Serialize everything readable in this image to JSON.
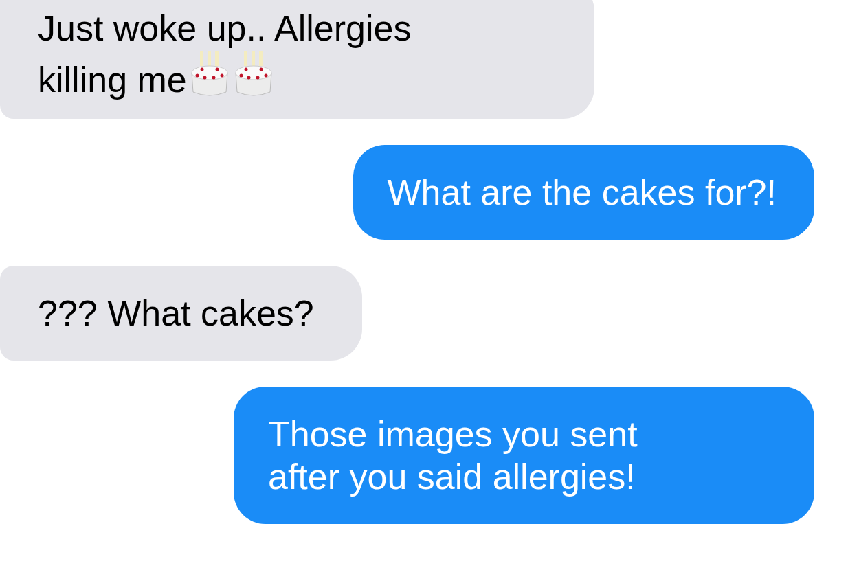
{
  "messages": [
    {
      "kind": "incoming",
      "parts": [
        {
          "kind": "text",
          "text": "Just woke up.. Allergies killing me"
        },
        {
          "kind": "cake"
        },
        {
          "kind": "cake"
        }
      ]
    },
    {
      "kind": "outgoing",
      "parts": [
        {
          "kind": "text",
          "text": "What are the cakes for?!"
        }
      ]
    },
    {
      "kind": "incoming",
      "parts": [
        {
          "kind": "text",
          "text": "??? What cakes?"
        }
      ]
    },
    {
      "kind": "outgoing",
      "parts": [
        {
          "kind": "text",
          "text": "Those images you sent after you said allergies!"
        }
      ]
    }
  ]
}
